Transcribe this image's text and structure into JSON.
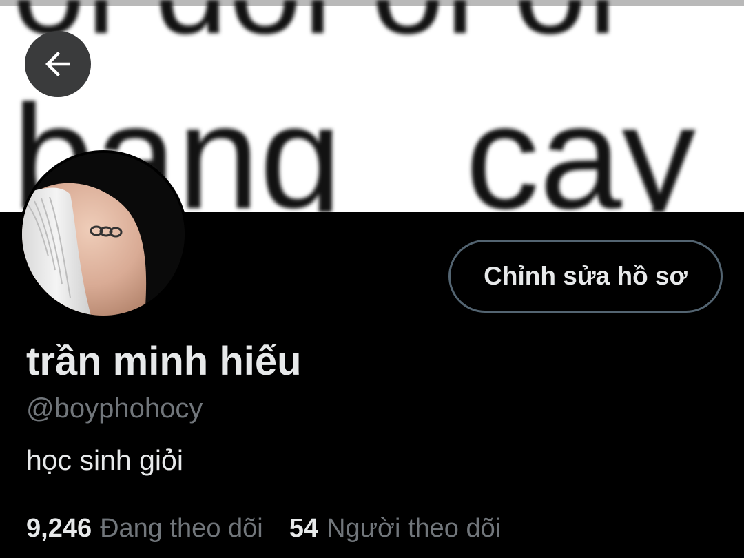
{
  "header": {
    "back_icon": "arrow-left-icon"
  },
  "banner": {
    "line_top": "ol dol ol ol",
    "line_bottom": "bang   cay"
  },
  "profile": {
    "display_name": "trần minh hiếu",
    "handle": "@boyphohocy",
    "bio": "học sinh giỏi",
    "edit_button_label": "Chỉnh sửa hồ sơ",
    "following_count": "9,246",
    "following_label": "Đang theo dõi",
    "followers_count": "54",
    "followers_label": "Người theo dõi"
  },
  "colors": {
    "background": "#000000",
    "text_primary": "#e7e9ea",
    "text_secondary": "#71767b",
    "button_border": "#536471",
    "back_button_bg": "#3a3b3c"
  }
}
